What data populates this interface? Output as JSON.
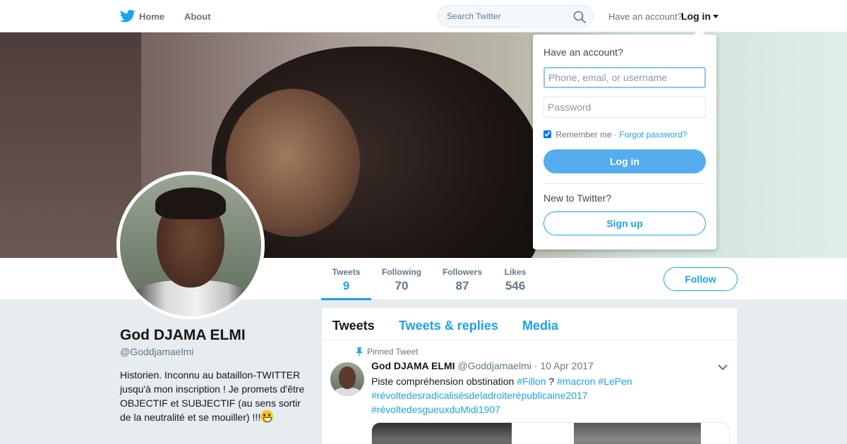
{
  "nav": {
    "home_label": "Home",
    "about_label": "About",
    "search_placeholder": "Search Twitter",
    "have_account": "Have an account?",
    "login_label": "Log in"
  },
  "profile": {
    "name": "God DJAMA ELMI",
    "handle": "@Goddjamaelmi",
    "bio": "Historien. Inconnu au bataillon-TWITTER jusqu'à mon inscription ! Je promets d'être OBJECTIF et SUBJECTIF (au sens sortir de la neutralité et se mouiller) !!!"
  },
  "stats": [
    {
      "label": "Tweets",
      "value": "9"
    },
    {
      "label": "Following",
      "value": "70"
    },
    {
      "label": "Followers",
      "value": "87"
    },
    {
      "label": "Likes",
      "value": "546"
    }
  ],
  "follow_label": "Follow",
  "timeline": {
    "tabs": [
      "Tweets",
      "Tweets & replies",
      "Media"
    ],
    "pinned_label": "Pinned Tweet",
    "tweet": {
      "name": "God DJAMA ELMI",
      "handle": "@Goddjamaelmi",
      "separator": "·",
      "date": "10 Apr 2017",
      "text_1": "Piste compréhension obstination",
      "tag_1": "#Fillon",
      "text_2": "?",
      "tag_2": "#macron",
      "tag_3": "#LePen",
      "tag_4": "#révoltedesradicalisésdeladroiterépublicaine2017",
      "tag_5": "#révoltedesgueuxduMidi1907"
    }
  },
  "login_dropdown": {
    "title": "Have an account?",
    "username_placeholder": "Phone, email, or username",
    "password_placeholder": "Password",
    "remember_label": "Remember me",
    "separator": "·",
    "forgot_label": "Forgot password?",
    "login_button": "Log in",
    "new_label": "New to Twitter?",
    "signup_button": "Sign up"
  },
  "colors": {
    "accent": "#1da1f2",
    "login_button": "#55acee",
    "background": "#e6ecf0"
  },
  "icons": [
    "twitter-bird-icon",
    "search-icon",
    "caret-down-icon",
    "pin-icon",
    "chevron-down-icon",
    "grinning-emoji-icon",
    "checkbox-icon"
  ]
}
